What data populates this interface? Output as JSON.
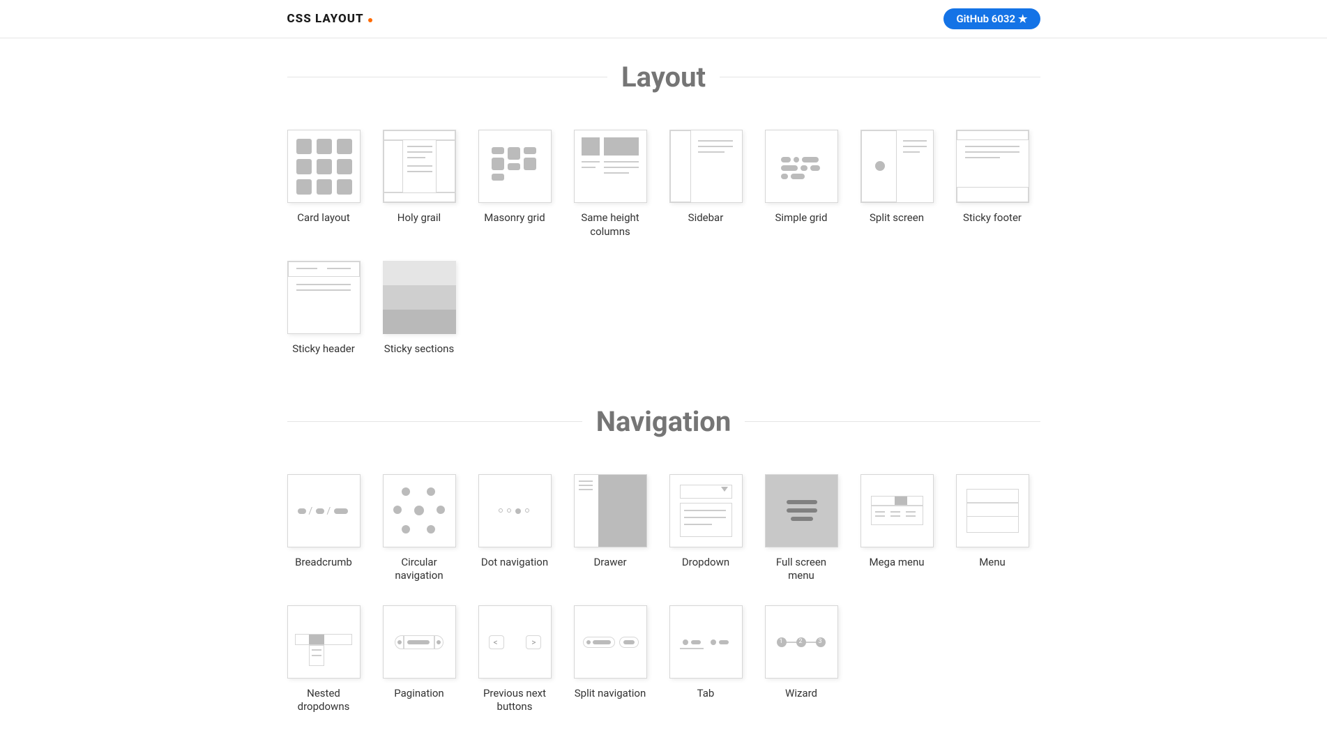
{
  "header": {
    "logo": "CSS LAYOUT",
    "github_label": "GitHub 6032"
  },
  "sections": [
    {
      "title": "Layout",
      "items": [
        "Card layout",
        "Holy grail",
        "Masonry grid",
        "Same height columns",
        "Sidebar",
        "Simple grid",
        "Split screen",
        "Sticky footer",
        "Sticky header",
        "Sticky sections"
      ]
    },
    {
      "title": "Navigation",
      "items": [
        "Breadcrumb",
        "Circular navigation",
        "Dot navigation",
        "Drawer",
        "Dropdown",
        "Full screen menu",
        "Mega menu",
        "Menu",
        "Nested dropdowns",
        "Pagination",
        "Previous next buttons",
        "Split navigation",
        "Tab",
        "Wizard"
      ]
    }
  ]
}
